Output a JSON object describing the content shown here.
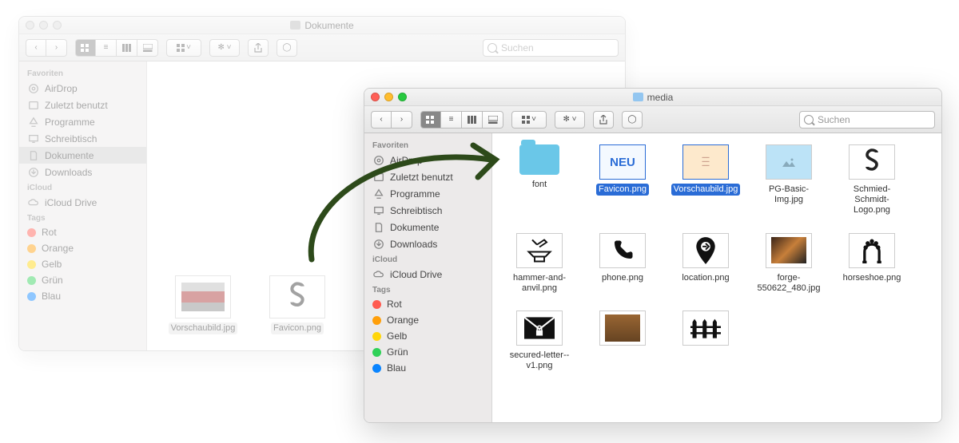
{
  "back_window": {
    "title": "Dokumente",
    "search_placeholder": "Suchen",
    "sidebar": {
      "favorites_label": "Favoriten",
      "items": [
        {
          "label": "AirDrop",
          "icon": "airdrop"
        },
        {
          "label": "Zuletzt benutzt",
          "icon": "recent"
        },
        {
          "label": "Programme",
          "icon": "apps"
        },
        {
          "label": "Schreibtisch",
          "icon": "desktop"
        },
        {
          "label": "Dokumente",
          "icon": "docs",
          "selected": true
        },
        {
          "label": "Downloads",
          "icon": "downloads"
        }
      ],
      "icloud_label": "iCloud",
      "icloud_items": [
        {
          "label": "iCloud Drive",
          "icon": "cloud"
        }
      ],
      "tags_label": "Tags",
      "tags": [
        {
          "label": "Rot",
          "color": "#ff5b50"
        },
        {
          "label": "Orange",
          "color": "#ff9f0a"
        },
        {
          "label": "Gelb",
          "color": "#ffd60a"
        },
        {
          "label": "Grün",
          "color": "#30d158"
        },
        {
          "label": "Blau",
          "color": "#0a84ff"
        }
      ]
    },
    "files": [
      {
        "name": "Vorschaubild.jpg",
        "type": "image"
      },
      {
        "name": "Favicon.png",
        "type": "image-s"
      }
    ]
  },
  "front_window": {
    "title": "media",
    "search_placeholder": "Suchen",
    "sidebar": {
      "favorites_label": "Favoriten",
      "items": [
        {
          "label": "AirDrop",
          "icon": "airdrop"
        },
        {
          "label": "Zuletzt benutzt",
          "icon": "recent"
        },
        {
          "label": "Programme",
          "icon": "apps"
        },
        {
          "label": "Schreibtisch",
          "icon": "desktop"
        },
        {
          "label": "Dokumente",
          "icon": "docs"
        },
        {
          "label": "Downloads",
          "icon": "downloads"
        }
      ],
      "icloud_label": "iCloud",
      "icloud_items": [
        {
          "label": "iCloud Drive",
          "icon": "cloud"
        }
      ],
      "tags_label": "Tags",
      "tags": [
        {
          "label": "Rot",
          "color": "#ff5b50"
        },
        {
          "label": "Orange",
          "color": "#ff9f0a"
        },
        {
          "label": "Gelb",
          "color": "#ffd60a"
        },
        {
          "label": "Grün",
          "color": "#30d158"
        },
        {
          "label": "Blau",
          "color": "#0a84ff"
        }
      ]
    },
    "files": [
      {
        "name": "font",
        "type": "folder"
      },
      {
        "name": "Favicon.png",
        "type": "neu",
        "selected": true
      },
      {
        "name": "Vorschaubild.jpg",
        "type": "preview",
        "selected": true
      },
      {
        "name": "PG-Basic-Img.jpg",
        "type": "imgph"
      },
      {
        "name": "Schmied-Schmidt-Logo.png",
        "type": "s-logo"
      },
      {
        "name": "hammer-and-anvil.png",
        "type": "hammer"
      },
      {
        "name": "phone.png",
        "type": "phone"
      },
      {
        "name": "location.png",
        "type": "location"
      },
      {
        "name": "forge-550622_480.jpg",
        "type": "forge"
      },
      {
        "name": "horseshoe.png",
        "type": "horseshoe"
      },
      {
        "name": "secured-letter--v1.png",
        "type": "letter"
      },
      {
        "name": "",
        "type": "img12"
      },
      {
        "name": "",
        "type": "fence"
      }
    ],
    "neu_label": "NEU"
  }
}
